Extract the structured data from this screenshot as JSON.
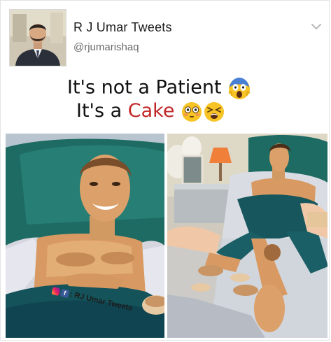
{
  "header": {
    "display_name": "R J Umar Tweets",
    "handle": "@rjumarishaq",
    "avatar_icon": "profile-photo",
    "menu_icon": "chevron-down-icon"
  },
  "tweet": {
    "line1": "It's not a Patient",
    "line2_prefix": "It's a ",
    "line2_highlight": "Cake",
    "highlight_color": "#c22727",
    "emojis": [
      "screaming-face-emoji",
      "flushed-face-emoji",
      "confounded-face-emoji"
    ]
  },
  "media": {
    "watermark_text": ": RJ Umar Tweets",
    "watermark_icons": [
      "instagram-icon",
      "facebook-icon"
    ],
    "facebook_glyph": "f"
  }
}
